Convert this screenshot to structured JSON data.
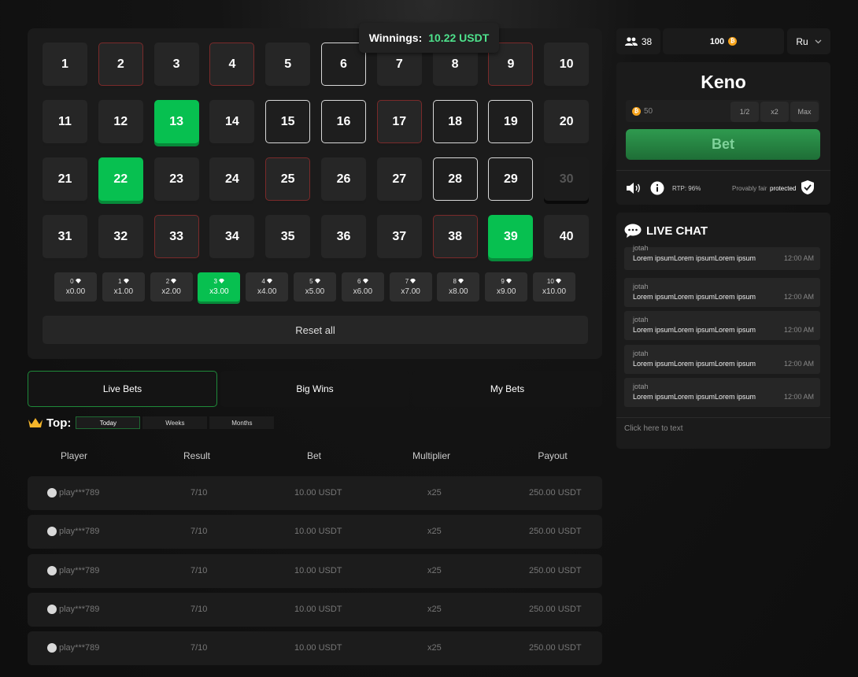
{
  "winnings": {
    "label": "Winnings:",
    "value": "10.22 USDT"
  },
  "board": {
    "cells": [
      {
        "n": "1",
        "s": ""
      },
      {
        "n": "2",
        "s": "red"
      },
      {
        "n": "3",
        "s": ""
      },
      {
        "n": "4",
        "s": "red"
      },
      {
        "n": "5",
        "s": ""
      },
      {
        "n": "6",
        "s": "outline"
      },
      {
        "n": "7",
        "s": ""
      },
      {
        "n": "8",
        "s": ""
      },
      {
        "n": "9",
        "s": "red"
      },
      {
        "n": "10",
        "s": ""
      },
      {
        "n": "11",
        "s": ""
      },
      {
        "n": "12",
        "s": ""
      },
      {
        "n": "13",
        "s": "green"
      },
      {
        "n": "14",
        "s": ""
      },
      {
        "n": "15",
        "s": "outline"
      },
      {
        "n": "16",
        "s": "outline"
      },
      {
        "n": "17",
        "s": "red"
      },
      {
        "n": "18",
        "s": "outline"
      },
      {
        "n": "19",
        "s": "outline"
      },
      {
        "n": "20",
        "s": ""
      },
      {
        "n": "21",
        "s": ""
      },
      {
        "n": "22",
        "s": "green"
      },
      {
        "n": "23",
        "s": ""
      },
      {
        "n": "24",
        "s": ""
      },
      {
        "n": "25",
        "s": "red"
      },
      {
        "n": "26",
        "s": ""
      },
      {
        "n": "27",
        "s": ""
      },
      {
        "n": "28",
        "s": "outline"
      },
      {
        "n": "29",
        "s": "outline"
      },
      {
        "n": "30",
        "s": "dim"
      },
      {
        "n": "31",
        "s": ""
      },
      {
        "n": "32",
        "s": ""
      },
      {
        "n": "33",
        "s": "red"
      },
      {
        "n": "34",
        "s": ""
      },
      {
        "n": "35",
        "s": ""
      },
      {
        "n": "36",
        "s": ""
      },
      {
        "n": "37",
        "s": ""
      },
      {
        "n": "38",
        "s": "red"
      },
      {
        "n": "39",
        "s": "green"
      },
      {
        "n": "40",
        "s": ""
      }
    ],
    "payouts": [
      {
        "hits": "0",
        "mult": "x0.00"
      },
      {
        "hits": "1",
        "mult": "x1.00"
      },
      {
        "hits": "2",
        "mult": "x2.00"
      },
      {
        "hits": "3",
        "mult": "x3.00",
        "active": true
      },
      {
        "hits": "4",
        "mult": "x4.00"
      },
      {
        "hits": "5",
        "mult": "x5.00"
      },
      {
        "hits": "6",
        "mult": "x6.00"
      },
      {
        "hits": "7",
        "mult": "x7.00"
      },
      {
        "hits": "8",
        "mult": "x8.00"
      },
      {
        "hits": "9",
        "mult": "x9.00"
      },
      {
        "hits": "10",
        "mult": "x10.00"
      }
    ],
    "reset_label": "Reset all"
  },
  "tabs": [
    "Live Bets",
    "Big Wins",
    "My Bets"
  ],
  "top": {
    "label": "Top:",
    "periods": [
      "Today",
      "Weeks",
      "Months"
    ]
  },
  "table": {
    "headers": [
      "Player",
      "Result",
      "Bet",
      "Multiplier",
      "Payout"
    ],
    "rows": [
      [
        "play***789",
        "7/10",
        "10.00 USDT",
        "x25",
        "250.00 USDT"
      ],
      [
        "play***789",
        "7/10",
        "10.00 USDT",
        "x25",
        "250.00 USDT"
      ],
      [
        "play***789",
        "7/10",
        "10.00 USDT",
        "x25",
        "250.00 USDT"
      ],
      [
        "play***789",
        "7/10",
        "10.00 USDT",
        "x25",
        "250.00 USDT"
      ],
      [
        "play***789",
        "7/10",
        "10.00 USDT",
        "x25",
        "250.00 USDT"
      ]
    ]
  },
  "header": {
    "online": "38",
    "balance": "100",
    "lang": "Ru"
  },
  "game": {
    "title": "Keno",
    "stake": "50",
    "half": "1/2",
    "double": "x2",
    "max": "Max",
    "bet_label": "Bet",
    "rtp": "RTP: 96%",
    "fair_prefix": "Provably fair",
    "fair_suffix": "protected"
  },
  "chat": {
    "title": "LIVE CHAT",
    "messages": [
      {
        "user": "jotah",
        "text": "Lorem ipsumLorem ipsumLorem ipsum",
        "time": "12:00 AM"
      },
      {
        "user": "jotah",
        "text": "Lorem ipsumLorem ipsumLorem ipsum",
        "time": "12:00 AM"
      },
      {
        "user": "jotah",
        "text": "Lorem ipsumLorem ipsumLorem ipsum",
        "time": "12:00 AM"
      },
      {
        "user": "jotah",
        "text": "Lorem ipsumLorem ipsumLorem ipsum",
        "time": "12:00 AM"
      },
      {
        "user": "jotah",
        "text": "Lorem ipsumLorem ipsumLorem ipsum",
        "time": "12:00 AM"
      }
    ],
    "placeholder": "Click here to text"
  },
  "colors": {
    "accent": "#07c050",
    "lost": "#7a2a2a",
    "coin": "#f6a31b"
  }
}
